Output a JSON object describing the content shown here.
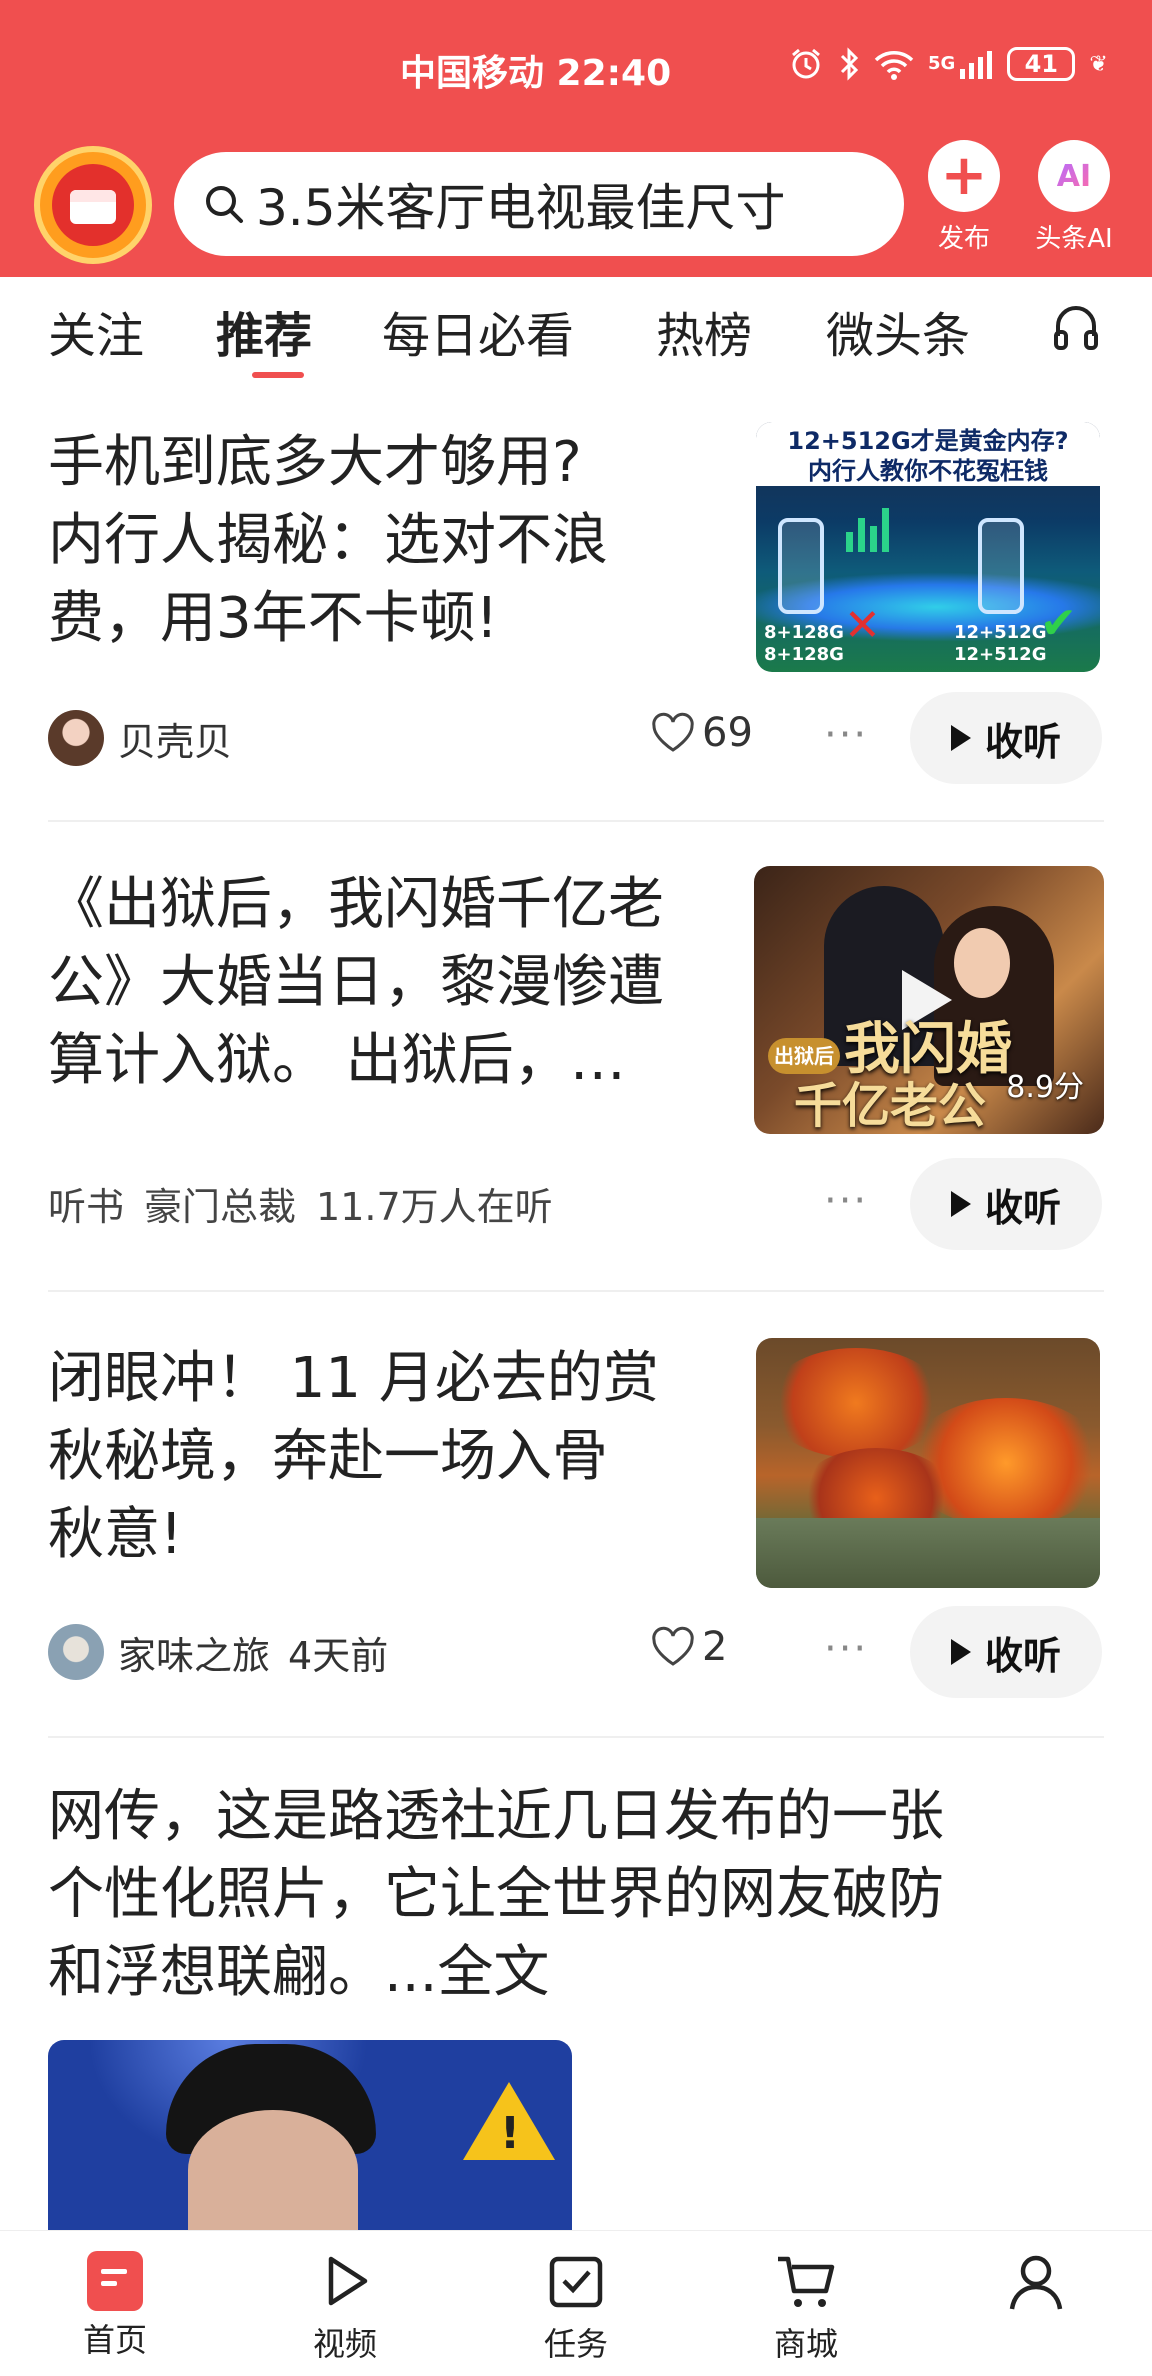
{
  "status_bar": {
    "carrier_time": "中国移动 22:40",
    "network": "5G",
    "battery": "41"
  },
  "header": {
    "search_query": "3.5米客厅电视最佳尺寸",
    "publish_label": "发布",
    "ai_icon_text": "AI",
    "ai_label": "头条AI",
    "accent_color": "#f04f4f"
  },
  "tabs": [
    {
      "label": "关注"
    },
    {
      "label": "推荐",
      "active": true
    },
    {
      "label": "每日必看"
    },
    {
      "label": "热榜"
    },
    {
      "label": "微头条"
    }
  ],
  "feed": {
    "items": [
      {
        "title_lines": [
          "手机到底多大才够用?",
          "内行人揭秘：选对不浪",
          "费，用3年不卡顿!"
        ],
        "thumb": {
          "caption_1": "12+512G才是黄金内存?",
          "caption_2": "内行人教你不花冤枉钱",
          "left_spec_1": "8+128G",
          "left_spec_2": "8+128G",
          "right_spec_1": "12+512G",
          "right_spec_2": "12+512G"
        },
        "author": "贝壳贝",
        "likes": "69",
        "more": "···",
        "listen_label": "收听"
      },
      {
        "title_lines": [
          "《出狱后，我闪婚千亿老",
          "公》大婚当日，黎漫惨遭",
          "算计入狱。 出狱后，…"
        ],
        "thumb": {
          "badge": "出狱后",
          "title_1": "我闪婚",
          "title_2": "千亿老公",
          "duration": "8.9分"
        },
        "meta": [
          "听书",
          "豪门总裁",
          "11.7万人在听"
        ],
        "more": "···",
        "listen_label": "收听"
      },
      {
        "title_lines": [
          "闭眼冲！ 11 月必去的赏",
          "秋秘境，奔赴一场入骨",
          "秋意!"
        ],
        "author": "家味之旅",
        "time": "4天前",
        "likes": "2",
        "more": "···",
        "listen_label": "收听"
      },
      {
        "title_lines": [
          "网传，这是路透社近几日发布的一张",
          "个性化照片，它让全世界的网友破防",
          "和浮想联翩。...全文"
        ]
      }
    ]
  },
  "bottom_nav": [
    {
      "label": "首页",
      "icon": "home-icon",
      "active": true
    },
    {
      "label": "视频",
      "icon": "video-icon"
    },
    {
      "label": "任务",
      "icon": "task-icon"
    },
    {
      "label": "商城",
      "icon": "cart-icon"
    },
    {
      "label": "",
      "icon": "profile-icon"
    }
  ]
}
